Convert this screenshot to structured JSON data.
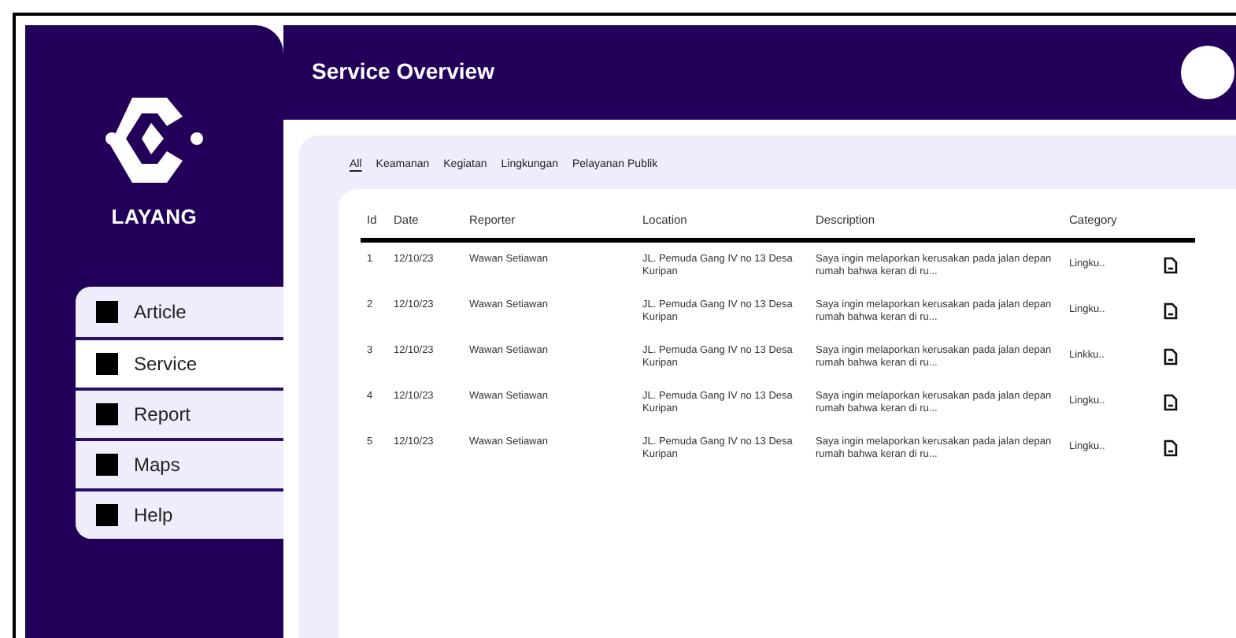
{
  "brand": "LAYANG",
  "nav": [
    {
      "label": "Article",
      "selected": false
    },
    {
      "label": "Service",
      "selected": true
    },
    {
      "label": "Report",
      "selected": false
    },
    {
      "label": "Maps",
      "selected": false
    },
    {
      "label": "Help",
      "selected": false
    }
  ],
  "header": {
    "title": "Service Overview"
  },
  "tabs": [
    {
      "label": "All",
      "selected": true
    },
    {
      "label": "Keamanan",
      "selected": false
    },
    {
      "label": "Kegiatan",
      "selected": false
    },
    {
      "label": "Lingkungan",
      "selected": false
    },
    {
      "label": "Pelayanan Publik",
      "selected": false
    }
  ],
  "table": {
    "columns": [
      "Id",
      "Date",
      "Reporter",
      "Location",
      "Description",
      "Category"
    ],
    "rows": [
      {
        "id": "1",
        "date": "12/10/23",
        "reporter": "Wawan Setiawan",
        "location": "JL. Pemuda Gang IV no 13 Desa Kuripan",
        "description": "Saya ingin melaporkan kerusakan pada jalan depan rumah bahwa keran di ru...",
        "category": "Lingku.."
      },
      {
        "id": "2",
        "date": "12/10/23",
        "reporter": "Wawan Setiawan",
        "location": "JL. Pemuda Gang IV no 13 Desa Kuripan",
        "description": "Saya ingin melaporkan kerusakan pada jalan depan rumah bahwa keran di ru...",
        "category": "Lingku.."
      },
      {
        "id": "3",
        "date": "12/10/23",
        "reporter": "Wawan Setiawan",
        "location": "JL. Pemuda Gang IV no 13 Desa Kuripan",
        "description": "Saya ingin melaporkan kerusakan pada jalan depan rumah bahwa keran di ru...",
        "category": "Linkku.."
      },
      {
        "id": "4",
        "date": "12/10/23",
        "reporter": "Wawan Setiawan",
        "location": "JL. Pemuda Gang IV no 13 Desa Kuripan",
        "description": "Saya ingin melaporkan kerusakan pada jalan depan rumah bahwa keran di ru...",
        "category": "Lingku.."
      },
      {
        "id": "5",
        "date": "12/10/23",
        "reporter": "Wawan Setiawan",
        "location": "JL. Pemuda Gang IV no 13 Desa Kuripan",
        "description": "Saya ingin melaporkan kerusakan pada jalan depan rumah bahwa keran di ru...",
        "category": "Lingku.."
      }
    ]
  }
}
